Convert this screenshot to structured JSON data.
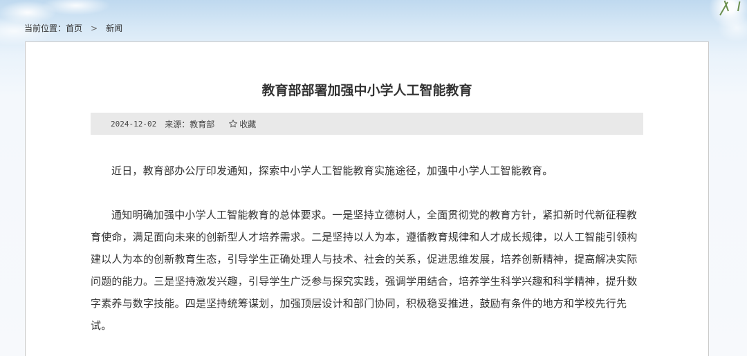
{
  "breadcrumb": {
    "label": "当前位置：",
    "home": "首页",
    "separator": ">",
    "current": "新闻"
  },
  "article": {
    "title": "教育部部署加强中小学人工智能教育",
    "date": "2024-12-02",
    "source": "来源：教育部",
    "favorite_label": "收藏",
    "paragraphs": [
      "近日，教育部办公厅印发通知，探索中小学人工智能教育实施途径，加强中小学人工智能教育。",
      "通知明确加强中小学人工智能教育的总体要求。一是坚持立德树人，全面贯彻党的教育方针，紧扣新时代新征程教育使命，满足面向未来的创新型人才培养需求。二是坚持以人为本，遵循教育规律和人才成长规律，以人工智能引领构建以人为本的创新教育生态，引导学生正确处理人与技术、社会的关系，促进思维发展，培养创新精神，提高解决实际问题的能力。三是坚持激发兴趣，引导学生广泛参与探究实践，强调学用结合，培养学生科学兴趣和科学精神，提升数字素养与数字技能。四是坚持统筹谋划，加强顶层设计和部门协同，积极稳妥推进，鼓励有条件的地方和学校先行先试。"
    ]
  },
  "colors": {
    "meta_bg": "#e9e9e9",
    "panel_border": "#c9c9c9",
    "text": "#333333"
  }
}
